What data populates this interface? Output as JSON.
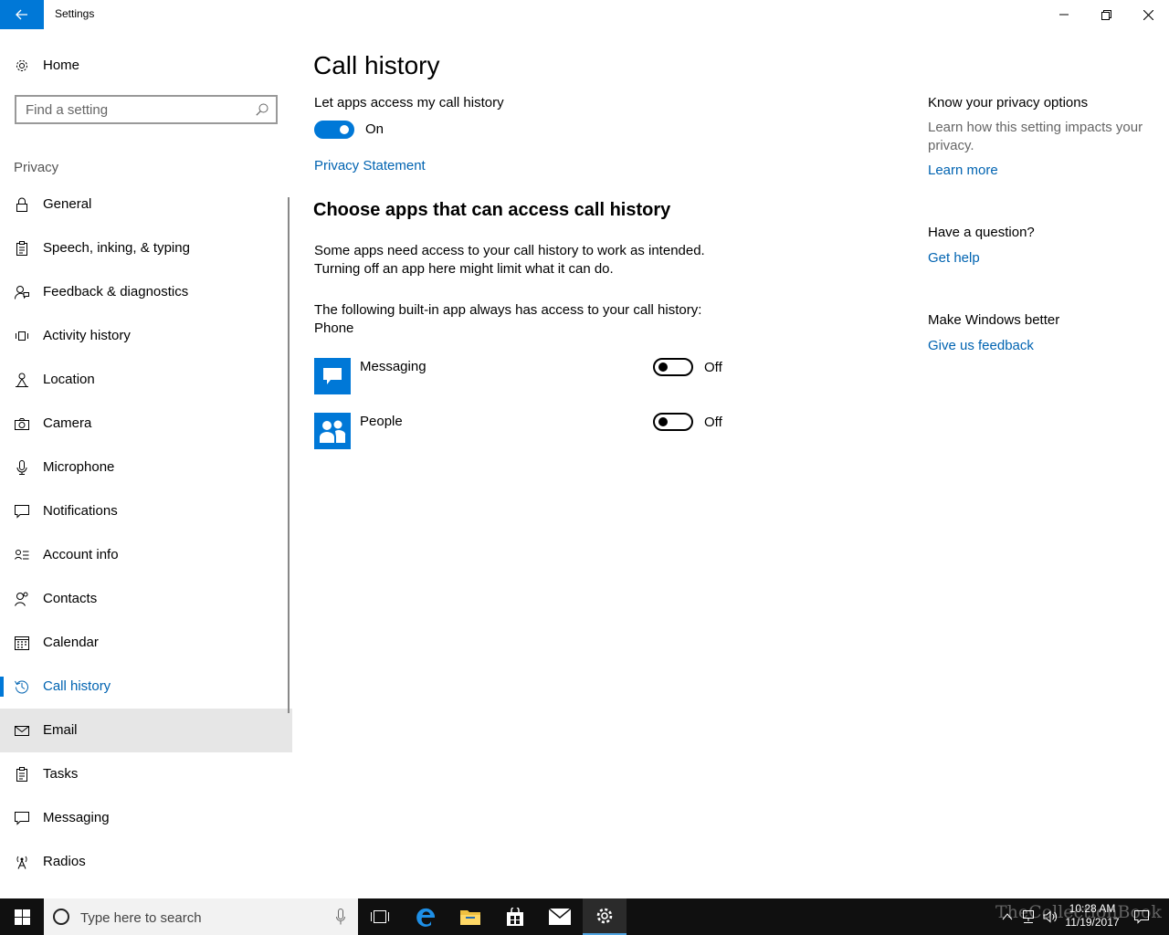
{
  "window": {
    "title": "Settings"
  },
  "sidebar": {
    "home_label": "Home",
    "search_placeholder": "Find a setting",
    "section_label": "Privacy",
    "items": [
      {
        "label": "General",
        "icon": "lock-icon"
      },
      {
        "label": "Speech, inking, & typing",
        "icon": "clipboard-icon"
      },
      {
        "label": "Feedback & diagnostics",
        "icon": "person-feedback-icon"
      },
      {
        "label": "Activity history",
        "icon": "activity-icon"
      },
      {
        "label": "Location",
        "icon": "location-person-icon"
      },
      {
        "label": "Camera",
        "icon": "camera-icon"
      },
      {
        "label": "Microphone",
        "icon": "microphone-icon"
      },
      {
        "label": "Notifications",
        "icon": "chat-bubble-icon"
      },
      {
        "label": "Account info",
        "icon": "account-info-icon"
      },
      {
        "label": "Contacts",
        "icon": "contacts-icon"
      },
      {
        "label": "Calendar",
        "icon": "calendar-icon"
      },
      {
        "label": "Call history",
        "icon": "history-icon"
      },
      {
        "label": "Email",
        "icon": "mail-icon"
      },
      {
        "label": "Tasks",
        "icon": "clipboard-icon"
      },
      {
        "label": "Messaging",
        "icon": "chat-bubble-icon"
      },
      {
        "label": "Radios",
        "icon": "radio-antenna-icon"
      }
    ],
    "active_item": "Call history",
    "hover_item": "Email"
  },
  "main": {
    "title": "Call history",
    "toggle_label": "Let apps access my call history",
    "toggle_state": "On",
    "privacy_link": "Privacy Statement",
    "subheading": "Choose apps that can access call history",
    "description_line1": "Some apps need access to your call history to work as intended.",
    "description_line2": "Turning off an app here might limit what it can do.",
    "builtin_line1": "The following built-in app always has access to your call history:",
    "builtin_line2": "Phone",
    "apps": [
      {
        "name": "Messaging",
        "state": "Off",
        "icon": "messaging-app-icon"
      },
      {
        "name": "People",
        "state": "Off",
        "icon": "people-app-icon"
      }
    ]
  },
  "right_panel": {
    "privacy_heading": "Know your privacy options",
    "privacy_text": "Learn how this setting impacts your privacy.",
    "learn_more": "Learn more",
    "question_heading": "Have a question?",
    "get_help": "Get help",
    "better_heading": "Make Windows better",
    "feedback_link": "Give us feedback"
  },
  "taskbar": {
    "search_placeholder": "Type here to search",
    "time": "10:28 AM",
    "date": "11/19/2017",
    "watermark": "TheCollectionBook"
  },
  "colors": {
    "accent": "#0078d7",
    "link": "#0063b1",
    "taskbar": "#101010"
  }
}
